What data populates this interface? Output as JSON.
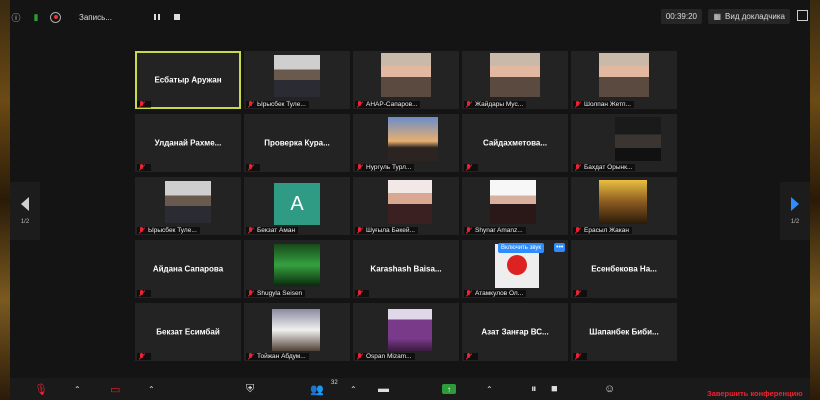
{
  "topbar": {
    "recording_label": "Запись...",
    "timer": "00:39:20",
    "view_label": "Вид докладчика"
  },
  "pager": {
    "left": "1/2",
    "right": "1/2"
  },
  "tiles": [
    {
      "type": "name",
      "label": "Есбатыр Аружан",
      "active": true
    },
    {
      "type": "video",
      "label": "Ырысбек Туле...",
      "photo": "p-group"
    },
    {
      "type": "video",
      "label": "АНАР-Сапаров...",
      "photo": "p-face",
      "muted": false
    },
    {
      "type": "video",
      "label": "Жайдары Мус...",
      "photo": "p-face"
    },
    {
      "type": "video",
      "label": "Шолпан Жетп...",
      "photo": "p-face"
    },
    {
      "type": "name",
      "label": "Улданай Рахме...",
      "muted": false
    },
    {
      "type": "name",
      "label": "Проверка Кура...",
      "muted": false
    },
    {
      "type": "video",
      "label": "Нургуль Турл...",
      "photo": "p-sunset"
    },
    {
      "type": "name",
      "label": "Сайдахметова...",
      "muted": false
    },
    {
      "type": "video",
      "label": "Бахдат Орынк...",
      "photo": "p-dark"
    },
    {
      "type": "video",
      "label": "Ырысбек Туле...",
      "photo": "p-group"
    },
    {
      "type": "avatar",
      "label": "Бекзат Аман",
      "letter": "A"
    },
    {
      "type": "video",
      "label": "Шуғыла Бәкей...",
      "photo": "p-girl"
    },
    {
      "type": "video",
      "label": "Shynar Amanz...",
      "photo": "p-girl2"
    },
    {
      "type": "video",
      "label": "Ерасыл Жакан",
      "photo": "p-warrior"
    },
    {
      "type": "name",
      "label": "Айдана Сапарова"
    },
    {
      "type": "video",
      "label": "Shugyla Seisen",
      "photo": "p-green"
    },
    {
      "type": "name",
      "label": "Karashash Baisa...",
      "muted": false
    },
    {
      "type": "logo",
      "label": "Атамкулов Ол...",
      "unmute": "Включить звук",
      "more": "•••"
    },
    {
      "type": "name",
      "label": "Есенбекова На..."
    },
    {
      "type": "name",
      "label": "Бекзат Есимбай"
    },
    {
      "type": "video",
      "label": "Тойжан Абдум...",
      "photo": "p-night"
    },
    {
      "type": "video",
      "label": "Ospan Mizam...",
      "photo": "p-hijab"
    },
    {
      "type": "name",
      "label": "Азат Занғар ВС..."
    },
    {
      "type": "name",
      "label": "Шапанбек Биби..."
    }
  ],
  "bottombar": {
    "participants_count": "32",
    "end_label": "Завершить конференцию"
  }
}
